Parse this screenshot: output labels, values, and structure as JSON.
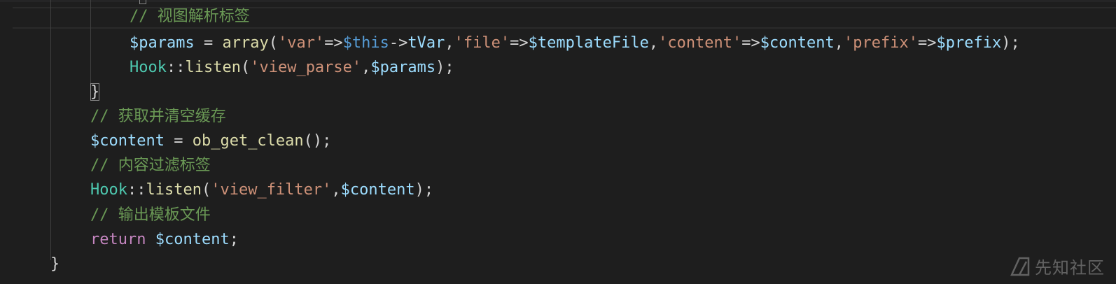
{
  "code_lines": [
    {
      "tokens": [
        {
          "t": "// 视图解析标签",
          "c": "comment"
        }
      ]
    },
    {
      "tokens": [
        {
          "t": "$params",
          "c": "var"
        },
        {
          "t": " = ",
          "c": "plain"
        },
        {
          "t": "array",
          "c": "func"
        },
        {
          "t": "(",
          "c": "plain"
        },
        {
          "t": "'var'",
          "c": "string"
        },
        {
          "t": "=>",
          "c": "plain"
        },
        {
          "t": "$this",
          "c": "this"
        },
        {
          "t": "->",
          "c": "plain"
        },
        {
          "t": "tVar",
          "c": "var"
        },
        {
          "t": ",",
          "c": "plain"
        },
        {
          "t": "'file'",
          "c": "string"
        },
        {
          "t": "=>",
          "c": "plain"
        },
        {
          "t": "$templateFile",
          "c": "var"
        },
        {
          "t": ",",
          "c": "plain"
        },
        {
          "t": "'content'",
          "c": "string"
        },
        {
          "t": "=>",
          "c": "plain"
        },
        {
          "t": "$content",
          "c": "var"
        },
        {
          "t": ",",
          "c": "plain"
        },
        {
          "t": "'prefix'",
          "c": "string"
        },
        {
          "t": "=>",
          "c": "plain"
        },
        {
          "t": "$prefix",
          "c": "var"
        },
        {
          "t": ");",
          "c": "plain"
        }
      ]
    },
    {
      "tokens": [
        {
          "t": "Hook",
          "c": "class"
        },
        {
          "t": "::",
          "c": "plain"
        },
        {
          "t": "listen",
          "c": "func"
        },
        {
          "t": "(",
          "c": "plain"
        },
        {
          "t": "'view_parse'",
          "c": "string"
        },
        {
          "t": ",",
          "c": "plain"
        },
        {
          "t": "$params",
          "c": "var"
        },
        {
          "t": ");",
          "c": "plain"
        }
      ]
    },
    {
      "tokens": [
        {
          "t": "}",
          "c": "plain",
          "match": true
        }
      ]
    },
    {
      "tokens": [
        {
          "t": "// 获取并清空缓存",
          "c": "comment"
        }
      ]
    },
    {
      "tokens": [
        {
          "t": "$content",
          "c": "var"
        },
        {
          "t": " = ",
          "c": "plain"
        },
        {
          "t": "ob_get_clean",
          "c": "func"
        },
        {
          "t": "();",
          "c": "plain"
        }
      ]
    },
    {
      "tokens": [
        {
          "t": "// 内容过滤标签",
          "c": "comment"
        }
      ]
    },
    {
      "tokens": [
        {
          "t": "Hook",
          "c": "class"
        },
        {
          "t": "::",
          "c": "plain"
        },
        {
          "t": "listen",
          "c": "func"
        },
        {
          "t": "(",
          "c": "plain"
        },
        {
          "t": "'view_filter'",
          "c": "string"
        },
        {
          "t": ",",
          "c": "plain"
        },
        {
          "t": "$content",
          "c": "var"
        },
        {
          "t": ");",
          "c": "plain"
        }
      ]
    },
    {
      "tokens": [
        {
          "t": "// 输出模板文件",
          "c": "comment"
        }
      ]
    },
    {
      "tokens": [
        {
          "t": "return",
          "c": "keyword"
        },
        {
          "t": " ",
          "c": "plain"
        },
        {
          "t": "$content",
          "c": "var"
        },
        {
          "t": ";",
          "c": "plain"
        }
      ]
    },
    {
      "tokens": [
        {
          "t": "}",
          "c": "plain"
        }
      ]
    }
  ],
  "watermark": {
    "text": "先知社区",
    "icon": "xianzhi-logo-icon"
  }
}
